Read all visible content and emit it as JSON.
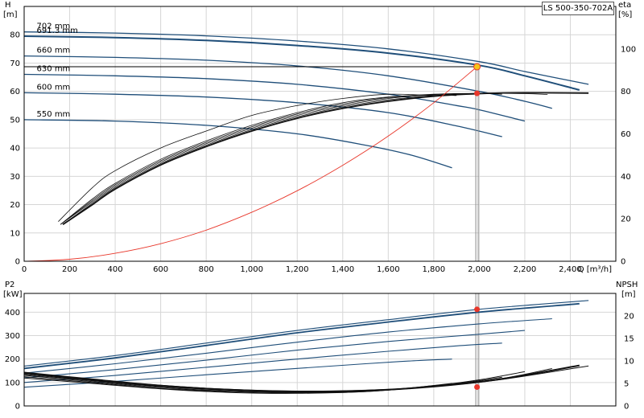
{
  "title_box": "LS 500-350-702A",
  "colors": {
    "curve_blue": "#1f4e79",
    "dark": "#111111",
    "system_curve": "#e8362a",
    "duty_point": "#e8362a",
    "duty_point_top": "#f5c518",
    "grid": "#d6d6d6"
  },
  "chart_data": [
    {
      "type": "line",
      "name_key": "head_efficiency",
      "xlabel": "Q [m³/h]",
      "ylabel": "H",
      "ylabel_unit": "[m]",
      "y2label": "eta",
      "y2label_unit": "[%]",
      "xlim": [
        0,
        2600
      ],
      "ylim": [
        0,
        90
      ],
      "y2lim": [
        0,
        120
      ],
      "x_ticks": [
        0,
        200,
        400,
        600,
        800,
        1000,
        1200,
        1400,
        1600,
        1800,
        2000,
        2200,
        2400
      ],
      "x_tick_labels": [
        "0",
        "200",
        "400",
        "600",
        "800",
        "1,000",
        "1,200",
        "1,400",
        "1,600",
        "1,800",
        "2,000",
        "2,200",
        "2,400"
      ],
      "y_ticks": [
        0,
        10,
        20,
        30,
        40,
        50,
        60,
        70,
        80
      ],
      "y2_ticks": [
        0,
        20,
        40,
        60,
        80,
        100
      ],
      "grid": true,
      "head_curves": [
        {
          "label": "702 mm",
          "x": [
            0,
            400,
            800,
            1200,
            1600,
            2000,
            2200,
            2480
          ],
          "y": [
            81,
            80.6,
            79.6,
            77.8,
            75,
            70.5,
            67,
            62.5
          ]
        },
        {
          "label": "691.3 mm",
          "x": [
            0,
            400,
            800,
            1200,
            1600,
            2000,
            2200,
            2440
          ],
          "y": [
            79.5,
            79,
            78,
            76.2,
            73.5,
            69.2,
            65.5,
            60.5
          ]
        },
        {
          "label": "660 mm",
          "x": [
            0,
            400,
            800,
            1200,
            1600,
            2000,
            2200,
            2320
          ],
          "y": [
            72.5,
            72,
            71,
            69,
            65.5,
            60,
            56.5,
            54
          ]
        },
        {
          "label": "630 mm",
          "x": [
            0,
            400,
            800,
            1200,
            1600,
            1900,
            2000,
            2200
          ],
          "y": [
            66,
            65.5,
            64.5,
            62.5,
            59,
            55,
            53.5,
            49.5
          ]
        },
        {
          "label": "600 mm",
          "x": [
            0,
            400,
            800,
            1200,
            1600,
            1900,
            2100
          ],
          "y": [
            59.5,
            59,
            58,
            56,
            52.5,
            47.8,
            44
          ]
        },
        {
          "label": "550 mm",
          "x": [
            0,
            400,
            800,
            1200,
            1500,
            1700,
            1880
          ],
          "y": [
            50,
            49.5,
            48,
            45,
            41,
            37.5,
            33
          ]
        }
      ],
      "efficiency_curves": [
        {
          "x": [
            150,
            300,
            400,
            600,
            800,
            1000,
            1200,
            1400,
            1600,
            1800
          ],
          "y": [
            14,
            26,
            32,
            40,
            46,
            51.5,
            55,
            57.5,
            59,
            58.5
          ]
        },
        {
          "x": [
            160,
            300,
            400,
            600,
            800,
            1000,
            1200,
            1400,
            1600,
            1800,
            1900
          ],
          "y": [
            13,
            22,
            27.5,
            36,
            42.5,
            48,
            52.5,
            56,
            58,
            58.8,
            58.5
          ]
        },
        {
          "x": [
            160,
            300,
            400,
            600,
            800,
            1000,
            1200,
            1400,
            1600,
            1800,
            2000,
            2100
          ],
          "y": [
            13,
            21.5,
            27,
            35.5,
            42,
            47.5,
            52,
            55.5,
            57.8,
            59,
            59.3,
            59
          ]
        },
        {
          "x": [
            160,
            300,
            400,
            600,
            800,
            1000,
            1200,
            1400,
            1600,
            1800,
            2000,
            2200,
            2300
          ],
          "y": [
            13,
            21,
            26.5,
            35,
            41.5,
            47,
            51.5,
            55,
            57.5,
            58.8,
            59.3,
            59.2,
            58.9
          ]
        },
        {
          "x": [
            170,
            300,
            400,
            600,
            800,
            1000,
            1200,
            1400,
            1600,
            1800,
            2000,
            2200,
            2400
          ],
          "y": [
            13,
            20.5,
            26,
            34.5,
            41,
            46.5,
            51,
            54.5,
            57,
            58.5,
            59.3,
            59.5,
            59.3
          ]
        },
        {
          "x": [
            170,
            300,
            400,
            600,
            800,
            1000,
            1200,
            1400,
            1600,
            1800,
            2000,
            2200,
            2480
          ],
          "y": [
            13,
            20,
            25.5,
            34,
            40.5,
            46,
            50.5,
            54,
            56.5,
            58.3,
            59.2,
            59.5,
            59.4
          ]
        }
      ],
      "system_curve": {
        "x": [
          0,
          200,
          400,
          600,
          800,
          1000,
          1200,
          1400,
          1600,
          1800,
          1990
        ],
        "y": [
          0,
          0.7,
          2.8,
          6.2,
          11,
          17.3,
          24.9,
          33.9,
          44.2,
          56,
          68.7
        ]
      },
      "operating_line": {
        "x": [
          0,
          1990
        ],
        "y": [
          68.7,
          68.7
        ]
      },
      "duty_flow": 1990,
      "duty_head": 68.7,
      "duty_eta": 59.3
    },
    {
      "type": "line",
      "name_key": "power_npsh",
      "ylabel": "P2",
      "ylabel_unit": "[kW]",
      "y2label": "NPSH",
      "y2label_unit": "[m]",
      "xlim": [
        0,
        2600
      ],
      "ylim": [
        0,
        480
      ],
      "y2lim": [
        0,
        25
      ],
      "y_ticks": [
        0,
        100,
        200,
        300,
        400
      ],
      "y2_ticks": [
        0,
        5,
        10,
        15,
        20
      ],
      "grid": true,
      "power_curves": [
        {
          "x": [
            0,
            400,
            800,
            1200,
            1600,
            2000,
            2480
          ],
          "y": [
            170,
            215,
            268,
            322,
            368,
            412,
            450
          ]
        },
        {
          "x": [
            0,
            400,
            800,
            1200,
            1600,
            2000,
            2440
          ],
          "y": [
            160,
            205,
            258,
            312,
            358,
            400,
            436
          ]
        },
        {
          "x": [
            0,
            400,
            800,
            1200,
            1600,
            2000,
            2320
          ],
          "y": [
            140,
            180,
            225,
            272,
            315,
            350,
            372
          ]
        },
        {
          "x": [
            0,
            400,
            800,
            1200,
            1600,
            2000,
            2200
          ],
          "y": [
            120,
            155,
            195,
            238,
            275,
            306,
            322
          ]
        },
        {
          "x": [
            0,
            400,
            800,
            1200,
            1600,
            1900,
            2100
          ],
          "y": [
            100,
            130,
            165,
            200,
            233,
            256,
            268
          ]
        },
        {
          "x": [
            0,
            400,
            800,
            1200,
            1500,
            1700,
            1880
          ],
          "y": [
            80,
            105,
            133,
            160,
            180,
            192,
            200
          ]
        }
      ],
      "npsh_curves": [
        {
          "x": [
            0,
            300,
            600,
            900,
            1200,
            1500,
            1800,
            2100,
            2480
          ],
          "y": [
            7.5,
            6.0,
            4.6,
            3.7,
            3.3,
            3.5,
            4.3,
            5.9,
            8.9
          ]
        },
        {
          "x": [
            0,
            300,
            600,
            900,
            1200,
            1500,
            1800,
            2100,
            2440
          ],
          "y": [
            7.3,
            5.8,
            4.5,
            3.6,
            3.2,
            3.4,
            4.3,
            6.0,
            9.0
          ]
        },
        {
          "x": [
            0,
            300,
            600,
            900,
            1200,
            1500,
            1800,
            2100,
            2320
          ],
          "y": [
            7.0,
            5.6,
            4.3,
            3.5,
            3.1,
            3.3,
            4.3,
            6.1,
            8.3
          ]
        },
        {
          "x": [
            0,
            300,
            600,
            900,
            1200,
            1500,
            1800,
            2000,
            2200
          ],
          "y": [
            6.8,
            5.4,
            4.1,
            3.3,
            3.0,
            3.3,
            4.5,
            5.8,
            7.6
          ]
        },
        {
          "x": [
            0,
            300,
            600,
            900,
            1200,
            1500,
            1800,
            2000,
            2100
          ],
          "y": [
            6.5,
            5.2,
            3.9,
            3.2,
            2.9,
            3.2,
            4.4,
            5.6,
            6.4
          ]
        },
        {
          "x": [
            0,
            300,
            600,
            900,
            1200,
            1500,
            1700,
            1880
          ],
          "y": [
            6.2,
            5.0,
            3.8,
            3.0,
            2.8,
            3.2,
            4.0,
            5.0
          ]
        }
      ],
      "duty_power": 412,
      "duty_npsh": 4.2
    }
  ]
}
